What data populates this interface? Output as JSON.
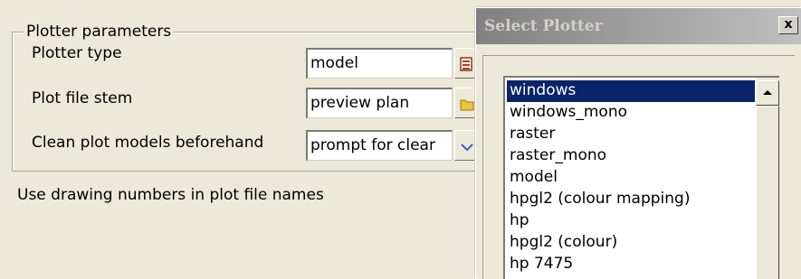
{
  "plotter_parameters": {
    "group_title": "Plotter parameters",
    "fields": [
      {
        "label": "Plotter type",
        "value": "model",
        "button_icon": "list-select-icon"
      },
      {
        "label": "Plot file stem",
        "value": "preview plan",
        "button_icon": "folder-icon"
      },
      {
        "label": "Clean plot models beforehand",
        "value": "prompt for clear",
        "button_icon": "chevron-down-icon"
      }
    ],
    "footer_label": "Use drawing numbers in plot file names"
  },
  "select_plotter": {
    "title": "Select Plotter",
    "close_label": "x",
    "selected_index": 0,
    "items": [
      "windows",
      "windows_mono",
      "raster",
      "raster_mono",
      "model",
      "hpgl2 (colour mapping)",
      "hp",
      "hpgl2 (colour)",
      "hp 7475"
    ]
  },
  "colors": {
    "selection": "#0a246a",
    "window_bg": "#ece9d8",
    "title_gradient_start": "#808080",
    "title_gradient_end": "#c0c0c0"
  }
}
